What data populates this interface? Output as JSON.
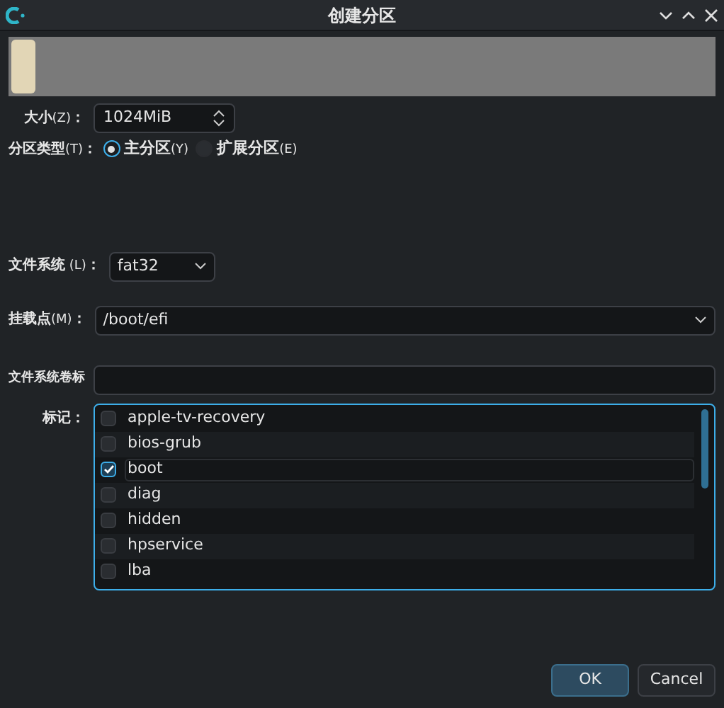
{
  "window": {
    "title": "创建分区"
  },
  "partition_bar": {
    "level": 0.035
  },
  "size": {
    "label": "大小",
    "mnemonic": "(Z)",
    "colon": "：",
    "value": "1024MiB"
  },
  "partition_type": {
    "label": "分区类型",
    "mnemonic": "(T)",
    "colon": "：",
    "options": [
      {
        "label": "主分区",
        "mnemonic": "(Y)",
        "selected": true
      },
      {
        "label": "扩展分区",
        "mnemonic": "(E)",
        "selected": false
      }
    ]
  },
  "file_system": {
    "label": "文件系统",
    "mnemonic": " (L)",
    "colon": "：",
    "value": "fat32"
  },
  "mount_point": {
    "label": "挂载点",
    "mnemonic": "(M)",
    "colon": "：",
    "value": "/boot/efi"
  },
  "volume_label": {
    "label": "文件系统卷标"
  },
  "flags": {
    "label": "标记：",
    "items": [
      {
        "label": "apple-tv-recovery",
        "checked": false,
        "focused": false
      },
      {
        "label": "bios-grub",
        "checked": false,
        "focused": false
      },
      {
        "label": "boot",
        "checked": true,
        "focused": true
      },
      {
        "label": "diag",
        "checked": false,
        "focused": false
      },
      {
        "label": "hidden",
        "checked": false,
        "focused": false
      },
      {
        "label": "hpservice",
        "checked": false,
        "focused": false
      },
      {
        "label": "lba",
        "checked": false,
        "focused": false
      }
    ]
  },
  "buttons": [
    {
      "label": "OK",
      "kind": "default"
    },
    {
      "label": "Cancel",
      "kind": "normal"
    }
  ]
}
